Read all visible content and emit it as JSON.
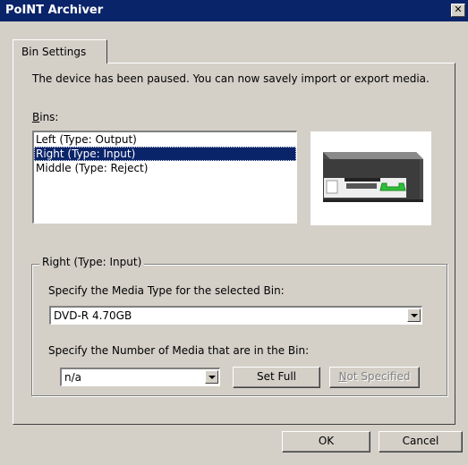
{
  "window": {
    "title": "PoINT Archiver",
    "close_glyph": "✕"
  },
  "tabs": [
    {
      "label": "Bin Settings",
      "selected": true
    }
  ],
  "description": "The device has been paused. You can now savely import or export media.",
  "bins": {
    "label_mnemonic": "B",
    "label_rest": "ins:",
    "items": [
      {
        "label": "Left (Type: Output)",
        "selected": false
      },
      {
        "label": "Right (Type: Input)",
        "selected": true
      },
      {
        "label": "Middle (Type: Reject)",
        "selected": false
      }
    ]
  },
  "device_image": {
    "icon": "disc-device-icon",
    "accent_color": "#2fbf3a"
  },
  "group": {
    "title": "Right (Type: Input)",
    "media_type_label": "Specify the Media Type for the selected Bin:",
    "media_type_value": "DVD-R 4.70GB",
    "media_count_label": "Specify the Number of Media that are in the Bin:",
    "media_count_value": "n/a",
    "set_full_label": "Set Full",
    "not_specified_mnemonic": "N",
    "not_specified_rest": "ot Specified"
  },
  "footer": {
    "ok_label": "OK",
    "cancel_label": "Cancel"
  },
  "colors": {
    "titlebar": "#0a246a",
    "face": "#d4d0c8",
    "selection": "#0a246a"
  }
}
